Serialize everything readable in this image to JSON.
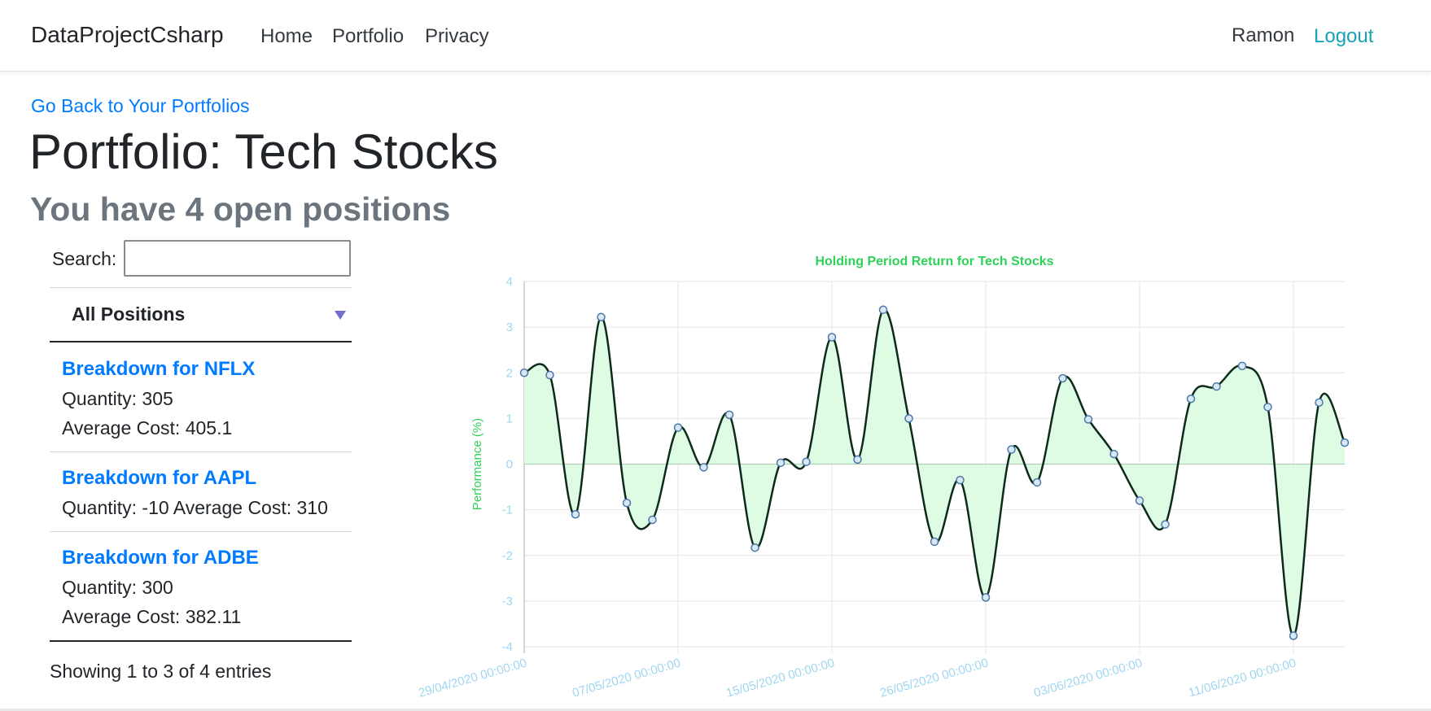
{
  "navbar": {
    "brand": "DataProjectCsharp",
    "links": [
      "Home",
      "Portfolio",
      "Privacy"
    ],
    "user": "Ramon",
    "logout": "Logout"
  },
  "header": {
    "back_link": "Go Back to Your Portfolios",
    "title": "Portfolio: Tech Stocks",
    "subtitle": "You have 4 open positions"
  },
  "sidebar": {
    "search_label": "Search:",
    "search_value": "",
    "filter_selected": "All Positions",
    "positions": [
      {
        "title": "Breakdown for NFLX",
        "lines": [
          "Quantity: 305",
          "Average Cost: 405.1"
        ]
      },
      {
        "title": "Breakdown for AAPL",
        "lines": [
          "Quantity: -10 Average Cost: 310"
        ]
      },
      {
        "title": "Breakdown for ADBE",
        "lines": [
          "Quantity: 300",
          "Average Cost: 382.11"
        ]
      }
    ],
    "entries_info": "Showing 1 to 3 of 4 entries"
  },
  "chart_data": {
    "type": "area",
    "title": "Holding Period Return for Tech Stocks",
    "ylabel": "Performance (%)",
    "xlabel": "",
    "ylim": [
      -4,
      4
    ],
    "yticks": [
      -4,
      -3,
      -2,
      -1,
      0,
      1,
      2,
      3,
      4
    ],
    "x_tick_labels": [
      "29/04/2020 00:00:00",
      "07/05/2020 00:00:00",
      "15/05/2020 00:00:00",
      "26/05/2020 00:00:00",
      "03/06/2020 00:00:00",
      "11/06/2020 00:00:00"
    ],
    "values": [
      2.0,
      1.95,
      -1.1,
      3.22,
      -0.85,
      -1.22,
      0.8,
      -0.07,
      1.08,
      -1.83,
      0.03,
      0.05,
      2.78,
      0.1,
      3.38,
      1.0,
      -1.7,
      -0.35,
      -2.92,
      0.32,
      -0.4,
      1.88,
      0.98,
      0.22,
      -0.8,
      -1.32,
      1.43,
      1.7,
      2.15,
      1.25,
      -3.76,
      1.35,
      0.47
    ],
    "grid": true,
    "colors": {
      "title": "#2ed158",
      "ylabel": "#2ed158",
      "line": "#0d2a1c",
      "fill": "#dcfbe3",
      "points": "#4a78a8",
      "ticks": "#9fd6ef"
    }
  }
}
